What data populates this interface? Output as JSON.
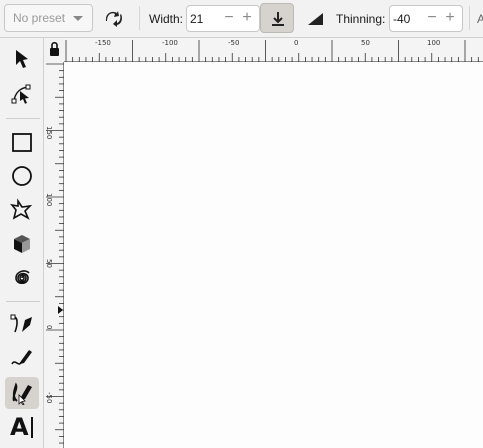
{
  "toolbar": {
    "preset_label": "No preset",
    "width_label": "Width:",
    "width_value": "21",
    "thinning_label": "Thinning:",
    "thinning_value": "-40",
    "cutoff_label": "A",
    "minus": "−",
    "plus": "+"
  },
  "ruler": {
    "h_labels": [
      "-150",
      "-100",
      "-50",
      "0",
      "50",
      "100"
    ],
    "v_labels": [
      "150",
      "100",
      "50",
      "0",
      "-50",
      "-100"
    ]
  },
  "tools": [
    {
      "name": "selector-tool",
      "icon": "arrow-icon",
      "active": false
    },
    {
      "name": "node-tool",
      "icon": "node-edit-icon",
      "active": false
    },
    {
      "name": "rectangle-tool",
      "icon": "rectangle-icon",
      "active": false
    },
    {
      "name": "ellipse-tool",
      "icon": "circle-icon",
      "active": false
    },
    {
      "name": "star-tool",
      "icon": "star-icon",
      "active": false
    },
    {
      "name": "3d-box-tool",
      "icon": "cube-icon",
      "active": false
    },
    {
      "name": "spiral-tool",
      "icon": "spiral-icon",
      "active": false
    },
    {
      "name": "bezier-tool",
      "icon": "pen-icon",
      "active": false
    },
    {
      "name": "pencil-tool",
      "icon": "pencil-icon",
      "active": false
    },
    {
      "name": "calligraphy-tool",
      "icon": "calligraphy-icon",
      "active": true
    },
    {
      "name": "text-tool",
      "icon": "text-icon",
      "active": false
    }
  ],
  "text_tool_label": "A",
  "colors": {
    "accent_pressed": "#d6d3cf",
    "canvas": "#fdfdfd",
    "panel": "#f2f2f2"
  }
}
